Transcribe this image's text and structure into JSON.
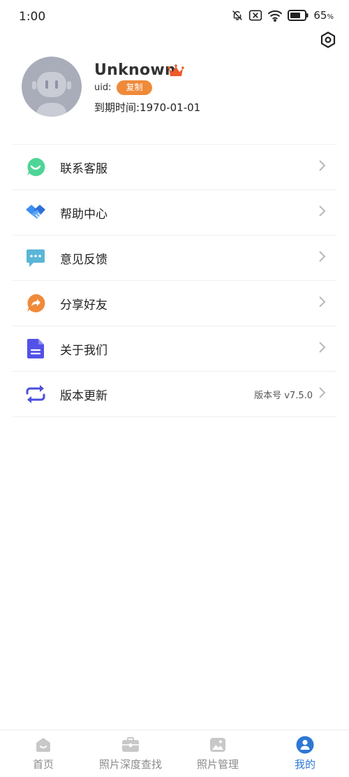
{
  "status_bar": {
    "time": "1:00",
    "battery": "65",
    "battery_unit": "%",
    "icons": [
      "bell-muted-icon",
      "sim-off-icon",
      "wifi-icon",
      "battery-icon"
    ]
  },
  "profile": {
    "name": "Unknown",
    "uid_label": "uid:",
    "copy_label": "复制",
    "expire_text": "到期时间:1970-01-01",
    "crown_color": "#ef5a2a"
  },
  "menu": {
    "items": [
      {
        "label": "联系客服",
        "icon": "customer-service-icon",
        "color": "#4fd497"
      },
      {
        "label": "帮助中心",
        "icon": "handshake-icon",
        "color": "#3d8df2"
      },
      {
        "label": "意见反馈",
        "icon": "feedback-icon",
        "color": "#5ab6d6"
      },
      {
        "label": "分享好友",
        "icon": "share-icon",
        "color": "#ef8a3a"
      },
      {
        "label": "关于我们",
        "icon": "document-icon",
        "color": "#5351e8"
      },
      {
        "label": "版本更新",
        "icon": "refresh-icon",
        "color": "#4b4fd9",
        "extra": "版本号 v7.5.0"
      }
    ]
  },
  "tabbar": {
    "tabs": [
      {
        "label": "首页",
        "icon": "home-icon",
        "active": false
      },
      {
        "label": "照片深度查找",
        "icon": "toolbox-icon",
        "active": false
      },
      {
        "label": "照片管理",
        "icon": "image-icon",
        "active": false
      },
      {
        "label": "我的",
        "icon": "profile-icon",
        "active": true
      }
    ],
    "active_color": "#2d78d5",
    "inactive_color": "#8a8a8a"
  }
}
